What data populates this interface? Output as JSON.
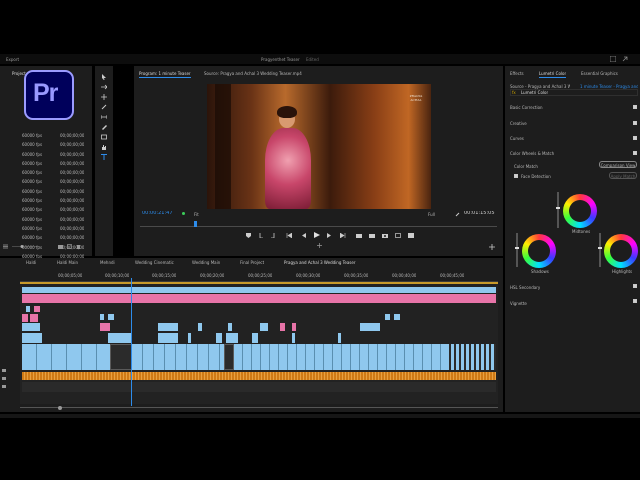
{
  "app": {
    "title": "Pragyenthet Teaser",
    "title_suffix": "Edited",
    "menu_export": "Export",
    "logo_text": "Pr"
  },
  "project": {
    "tab": "Project",
    "rows": [
      {
        "fps": "60000 fps",
        "tc": "00;00;00;00"
      },
      {
        "fps": "60000 fps",
        "tc": "00;00;00;00"
      },
      {
        "fps": "60000 fps",
        "tc": "00;00;00;00"
      },
      {
        "fps": "60000 fps",
        "tc": "00;00;00;00"
      },
      {
        "fps": "60000 fps",
        "tc": "00;00;00;00"
      },
      {
        "fps": "60000 fps",
        "tc": "00;00;00;00"
      },
      {
        "fps": "60000 fps",
        "tc": "00;00;00;00"
      },
      {
        "fps": "60000 fps",
        "tc": "00;00;00;00"
      },
      {
        "fps": "60000 fps",
        "tc": "00;00;00;00"
      },
      {
        "fps": "60000 fps",
        "tc": "00;00;00;00"
      },
      {
        "fps": "60000 fps",
        "tc": "00;00;00;00"
      },
      {
        "fps": "60000 fps",
        "tc": "00;00;00;00"
      },
      {
        "fps": "60000 fps",
        "tc": "00;00;00;00"
      },
      {
        "fps": "60000 fps",
        "tc": "00;00;00;00"
      },
      {
        "fps": "60000 fps",
        "tc": "00;00;00;00"
      },
      {
        "fps": "60000 fps",
        "tc": "00;00;00;00"
      },
      {
        "fps": "60000 fps",
        "tc": "00;00;00;00"
      },
      {
        "fps": "60000 fps",
        "tc": "00;00;00;00"
      },
      {
        "fps": "60000 fps",
        "tc": "00;00;00;00"
      }
    ]
  },
  "program": {
    "tab_program": "Program: 1 minute Teaser",
    "tab_source": "Source: Pragya and Achal 3 Wedding Teaser.mp4",
    "watermark": "PRAGYA ACHAL",
    "timecode_in": "00:00:21:47",
    "fit": "Fit",
    "quality": "Full",
    "timecode_out": "00:01:15:05"
  },
  "timeline": {
    "tabs": [
      "Haldi",
      "Haldi Main",
      "Mehndi",
      "Wedding Cinematic",
      "Wedding Main",
      "Final Project",
      "Pragya and Achal 3 Wedding Teaser"
    ],
    "ruler": [
      "00;00;05;00",
      "00;00;10;00",
      "00;00;15;00",
      "00;00;20;00",
      "00;00;25;00",
      "00;00;30;00",
      "00;00;35;00",
      "00;00;40;00",
      "00;00;45;00"
    ]
  },
  "right_panel": {
    "tabs": [
      "Effects",
      "Lumetri Color",
      "Essential Graphics"
    ],
    "source": "Source - Pragya and Achal 3 We...",
    "target": "1 minute Teaser - Pragya and Achal 3 ...",
    "fx": "fx",
    "effect_name": "Lumetri Color",
    "sections": {
      "basic": "Basic Correction",
      "creative": "Creative",
      "curves": "Curves",
      "wheels": "Color Wheels & Match",
      "hsl": "HSL Secondary",
      "vignette": "Vignette"
    },
    "color_match": "Color Match",
    "comparison_btn": "Comparison View",
    "face_detection": "Face Detection",
    "apply_match": "Apply Match",
    "midtones": "Midtones",
    "shadows": "Shadows",
    "highlights": "Highlights"
  },
  "colors": {
    "accent_blue": "#2d8ceb",
    "clip_video": "#8fc8ee",
    "clip_pink": "#e774a8",
    "clip_audio": "#cf7a16",
    "panel": "#1d1d1d"
  }
}
